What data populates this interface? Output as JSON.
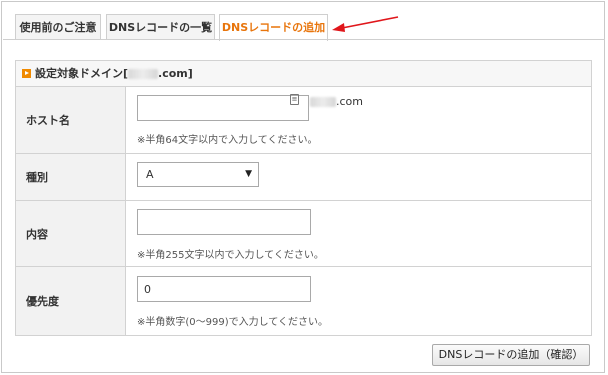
{
  "tabs": [
    {
      "label": "使用前のご注意",
      "active": false
    },
    {
      "label": "DNSレコードの一覧",
      "active": false
    },
    {
      "label": "DNSレコードの追加",
      "active": true
    }
  ],
  "panel": {
    "title_prefix": "設定対象ドメイン[",
    "title_suffix": ".com]"
  },
  "form": {
    "host": {
      "label": "ホスト名",
      "value": "",
      "domain_suffix": ".com",
      "hint": "※半角64文字以内で入力してください。"
    },
    "type": {
      "label": "種別",
      "selected": "A"
    },
    "content": {
      "label": "内容",
      "value": "",
      "hint": "※半角255文字以内で入力してください。"
    },
    "priority": {
      "label": "優先度",
      "value": "0",
      "hint": "※半角数字(0〜999)で入力してください。"
    }
  },
  "submit_label": "DNSレコードの追加（確認）",
  "colors": {
    "active_tab": "#e8750c",
    "arrow": "#e0161b",
    "header_icon": "#f08a00"
  }
}
